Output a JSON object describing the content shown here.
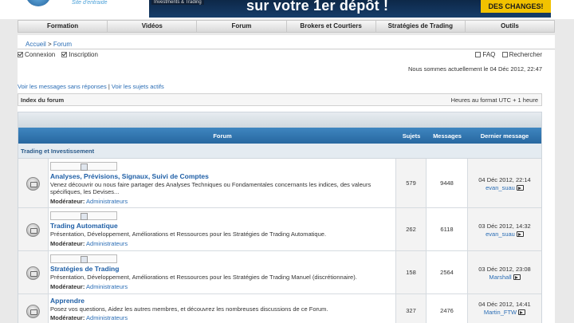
{
  "header": {
    "logo_text": "Site d'entraide",
    "banner_small": "Investments & Trading",
    "banner_big": "sur votre 1er dépôt !",
    "banner_badge": "DES CHANGES!"
  },
  "nav": [
    "Formation",
    "Vidéos",
    "Forum",
    "Brokers et Courtiers",
    "Stratégies de Trading",
    "Outils"
  ],
  "breadcrumb": {
    "home": "Accueil",
    "sep": " > ",
    "current": "Forum"
  },
  "login": {
    "connexion": "Connexion",
    "inscription": "Inscription",
    "faq": "FAQ",
    "search": "Rechercher"
  },
  "date_line": "Nous sommes actuellement le 04 Déc 2012, 22:47",
  "links": {
    "unanswered": "Voir les messages sans réponses",
    "sep": " | ",
    "active": "Voir les sujets actifs"
  },
  "index_bar": {
    "left": "Index du forum",
    "right": "Heures au format UTC + 1 heure"
  },
  "table_headers": {
    "forum": "Forum",
    "sujets": "Sujets",
    "messages": "Messages",
    "last": "Dernier message"
  },
  "category": "Trading et Investissement",
  "forums": [
    {
      "title": "Analyses, Prévisions, Signaux, Suivi de Comptes",
      "desc": "Venez découvrir ou nous faire partager des Analyses Techniques ou Fondamentales concernants les indices, des valeurs spécifiques, les Devises...",
      "mod_label": "Modérateur:",
      "mod": "Administrateurs",
      "sujets": "579",
      "messages": "9448",
      "last_date": "04 Déc 2012, 22:14",
      "last_user": "evan_suau"
    },
    {
      "title": "Trading Automatique",
      "desc": "Présentation, Développement, Améliorations et Ressources pour les Stratégies de Trading Automatique.",
      "mod_label": "Modérateur:",
      "mod": "Administrateurs",
      "sujets": "262",
      "messages": "6118",
      "last_date": "03 Déc 2012, 14:32",
      "last_user": "evan_suau"
    },
    {
      "title": "Stratégies de Trading",
      "desc": "Présentation, Développement, Améliorations et Ressources pour les Stratégies de Trading Manuel (discrétionnaire).",
      "mod_label": "Modérateur:",
      "mod": "Administrateurs",
      "sujets": "158",
      "messages": "2564",
      "last_date": "03 Déc 2012, 23:08",
      "last_user": "Marshall"
    },
    {
      "title": "Apprendre",
      "desc": "Posez vos questions, Aidez les autres membres, et découvrez les nombreuses discussions de ce Forum.",
      "mod_label": "Modérateur:",
      "mod": "Administrateurs",
      "sujets": "327",
      "messages": "2476",
      "last_date": "04 Déc 2012, 14:41",
      "last_user": "Martin_FTW"
    }
  ]
}
